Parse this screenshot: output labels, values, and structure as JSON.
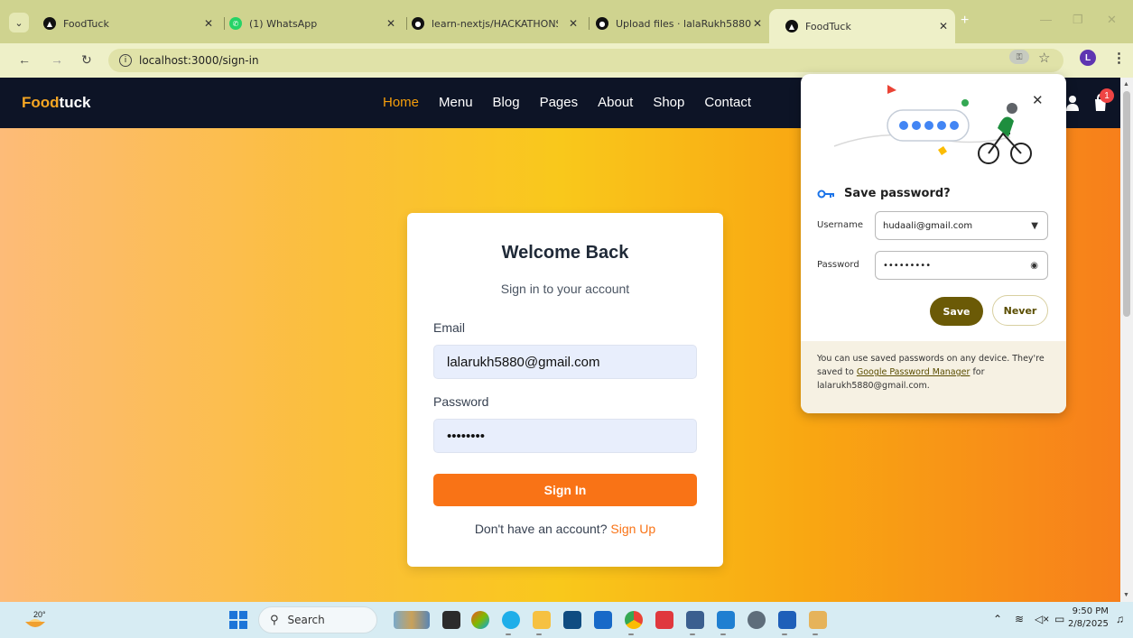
{
  "browser": {
    "tabs": [
      {
        "label": "FoodTuck",
        "favicon": "foodtuck-icon",
        "active": false
      },
      {
        "label": "(1) WhatsApp",
        "favicon": "whatsapp-icon",
        "active": false
      },
      {
        "label": "learn-nextjs/HACKATHONS/",
        "favicon": "github-icon",
        "active": false
      },
      {
        "label": "Upload files · lalaRukh5880/",
        "favicon": "github-icon",
        "active": false
      },
      {
        "label": "FoodTuck",
        "favicon": "foodtuck-icon",
        "active": true
      }
    ],
    "url": "localhost:3000/sign-in",
    "profile_initial": "L"
  },
  "site": {
    "brand_part1": "Food",
    "brand_part2": "tuck",
    "nav": [
      "Home",
      "Menu",
      "Blog",
      "Pages",
      "About",
      "Shop",
      "Contact"
    ],
    "active_nav": "Home",
    "cart_count": "1"
  },
  "signin": {
    "title": "Welcome Back",
    "subtitle": "Sign in to your account",
    "email_label": "Email",
    "email_value": "lalarukh5880@gmail.com",
    "password_label": "Password",
    "password_value": "••••••••",
    "button": "Sign In",
    "signup_prompt": "Don't have an account?",
    "signup_link": "Sign Up"
  },
  "password_manager": {
    "title": "Save password?",
    "username_label": "Username",
    "username_value": "hudaali@gmail.com",
    "password_label": "Password",
    "password_value": "•••••••••",
    "save": "Save",
    "never": "Never",
    "foot_1": "You can use saved passwords on any device. They're saved to",
    "foot_link": "Google Password Manager",
    "foot_2": "for lalarukh5880@gmail.com."
  },
  "taskbar": {
    "temperature": "20°",
    "search_placeholder": "Search",
    "time": "9:50 PM",
    "date": "2/8/2025"
  },
  "colors": {
    "accent": "#f97316",
    "nav_bg": "#0d1426",
    "save_btn": "#6b5a06"
  }
}
